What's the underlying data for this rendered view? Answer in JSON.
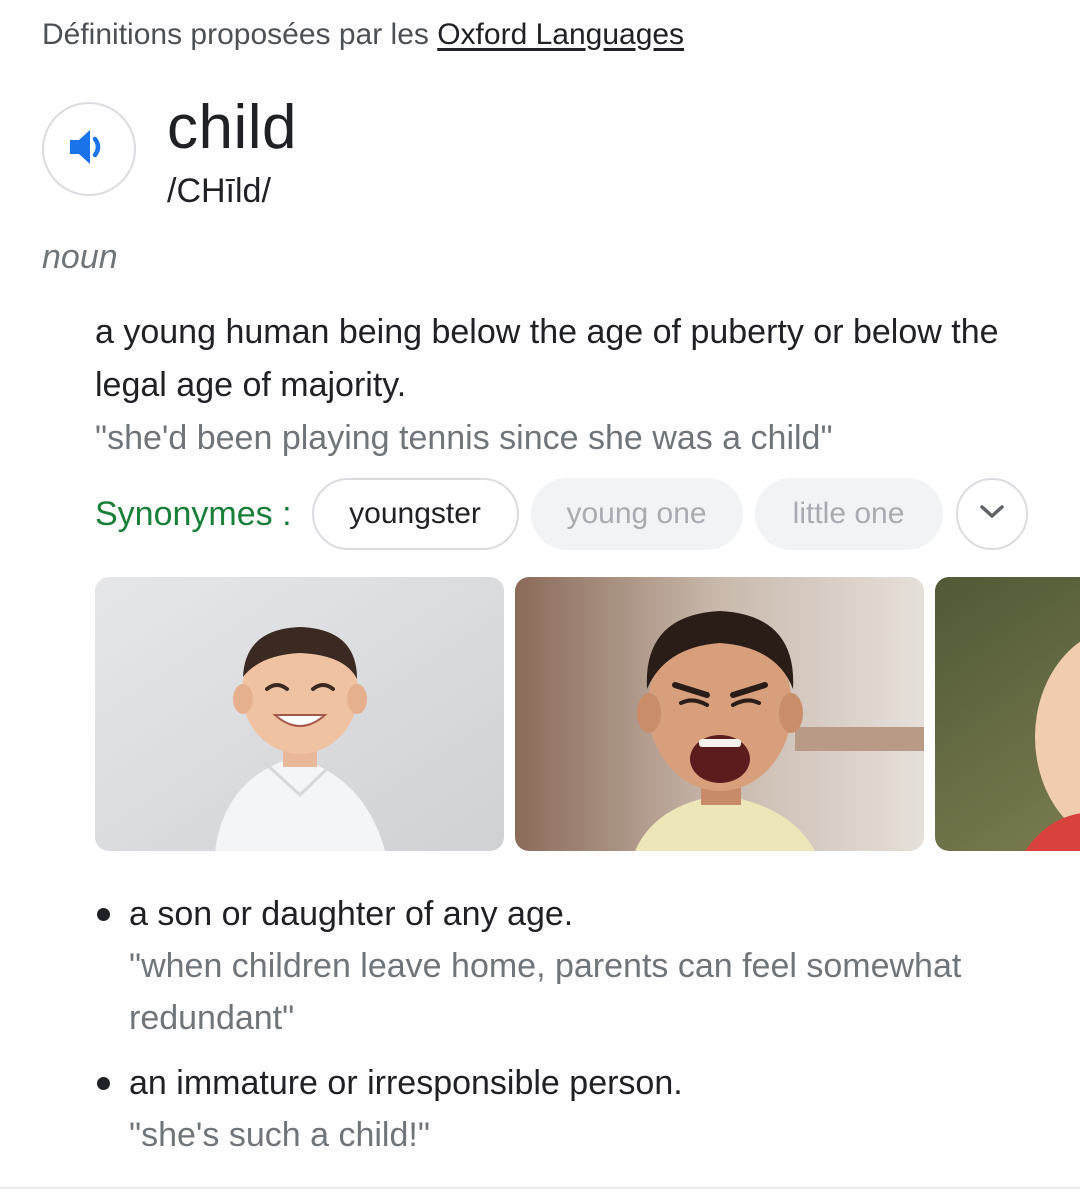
{
  "source": {
    "prefix": "Définitions proposées par les ",
    "link_label": "Oxford Languages"
  },
  "entry": {
    "audio_icon": "speaker-icon",
    "word": "child",
    "phonetic": "/CHīld/",
    "part_of_speech": "noun"
  },
  "senses": [
    {
      "definition": "a young human being below the age of puberty or below the legal age of majority.",
      "example": "\"she'd been playing tennis since she was a child\""
    },
    {
      "definition": "a son or daughter of any age.",
      "example": "\"when children leave home, parents can feel somewhat redundant\""
    },
    {
      "definition": "an immature or irresponsible person.",
      "example": "\"she's such a child!\""
    }
  ],
  "synonyms": {
    "label": "Synonymes :",
    "items": [
      "youngster",
      "young one",
      "little one"
    ],
    "expand_icon": "chevron-down-icon"
  },
  "images": {
    "count_visible": 3,
    "items": [
      "smiling-toddler-photo",
      "shouting-boy-photo",
      "baby-photo"
    ]
  },
  "colors": {
    "text": "#202124",
    "muted": "#70757a",
    "synonym_label": "#188038",
    "accent": "#1a73e8",
    "border": "#dadce0"
  }
}
